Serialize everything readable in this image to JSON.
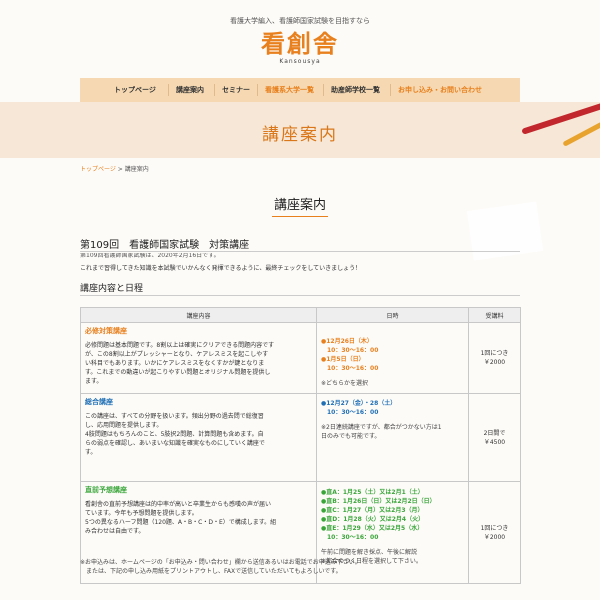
{
  "header": {
    "tagline": "看護大学編入、看護師国家試験を目指すなら",
    "logo_main": "看創舎",
    "logo_sub": "Kansousya"
  },
  "nav": {
    "items": [
      {
        "label": "トップページ"
      },
      {
        "label": "講座案内"
      },
      {
        "label": "セミナー"
      },
      {
        "label": "看護系大学一覧",
        "active": true
      },
      {
        "label": "助産師学校一覧"
      },
      {
        "label": "お申し込み・お問い合わせ",
        "active": true
      }
    ]
  },
  "banner": {
    "title": "講座案内"
  },
  "breadcrumb": {
    "home": "トップページ",
    "separator": " > ",
    "current": "講座案内"
  },
  "main": {
    "section_title": "講座案内",
    "exam_heading": "第109回　看護師国家試験　対策講座",
    "exam_date": "第109回看護師国家試験は、2020年2月16日です。",
    "intro": "これまで習得してきた知識を本試験でいかんなく発揮できるように、最終チェックをしていきましょう！",
    "content_heading": "講座内容と日程"
  },
  "table": {
    "headers": [
      "講座内容",
      "日時",
      "受講料"
    ],
    "rows": [
      {
        "title": "必修対策講座",
        "title_color": "#e8801e",
        "date_color": "#e8801e",
        "desc": [
          "必修問題は基本問題です。8割以上は確実にクリアできる問題内容です",
          "が、この8割以上がプレッシャーとなり、ケアレスミスを起こしやす",
          "い科目でもあります。いかにケアレスミスをなくすかが鍵となりま",
          "す。これまでの動違いが起こりやすい問題とオリジナル問題を提供し",
          "ます。"
        ],
        "dates": [
          "●12月26日（木）",
          "　10：30〜16：00",
          "●1月5日（日）",
          "　10：30〜16：00"
        ],
        "notes": [
          "※どちらかを選択"
        ],
        "fee": [
          "1回につき",
          "￥2000"
        ]
      },
      {
        "title": "総合講座",
        "title_color": "#1f6fb5",
        "date_color": "#1f6fb5",
        "desc": [
          "この講座は、すべての分野を扱います。頻出分野の過去問で総復習",
          "し、応用問題を提供します。",
          "4肢問題はもちろんのこと、5肢択2問題、計算問題も含めます。自",
          "らの弱点を確認し、あいまいな知識を確実なものにしていく講座で",
          "す。"
        ],
        "dates": [
          "●12月27（金）・28（土）",
          "　10：30〜16：00"
        ],
        "notes": [
          "※2日連続講座ですが、都合がつかない方は1",
          "日のみでも可能です。"
        ],
        "fee": [
          "2日間で",
          "￥4500"
        ]
      },
      {
        "title": "直前予想講座",
        "title_color": "#3aa63a",
        "date_color": "#3aa63a",
        "desc": [
          "看創舎の直前予想講座は的中率が高いと卒業生からも感嘆の声が届い",
          "ています。今年も予想問題を提供します。",
          "5つの異なるハーフ問題（120題、A・B・C・D・E）で構成します。組",
          "み合わせは自由です。"
        ],
        "dates": [
          "●直A：1月25（土）又は2月1（土）",
          "●直B：1月26日（日）又は2月2日（日）",
          "●直C：1月27（月）又は2月3（月）",
          "●直D：1月28（火）又は2月4（火）",
          "●直E：1月29（水）又は2月5（水）",
          "　10：30〜16：00"
        ],
        "notes": [
          "午前に問題を解き採点、午後に解説",
          "※都合のつく日程を選択して下さい。"
        ],
        "fee": [
          "1回につき",
          "￥2000"
        ]
      }
    ]
  },
  "footnote": [
    "※お申込みは、ホームページの「お申込み・問い合わせ」欄から送信あるいはお電話でお申込み下さい。",
    "　または、下記の申し込み用紙をプリントアウトし、FAXで送信していただいてもよろしいです。"
  ]
}
